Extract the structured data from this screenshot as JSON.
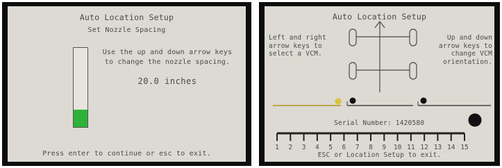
{
  "left_screen": {
    "title": "Auto Location Setup",
    "subtitle": "Set Nozzle Spacing",
    "instruction": "Use the up and down arrow keys to change the nozzle spacing.",
    "value": "20.0 inches",
    "level_fraction": 0.22,
    "fill_color": "#2fb23a",
    "footer": "Press enter to continue or esc to exit."
  },
  "right_screen": {
    "title": "Auto Location Setup",
    "left_instruction": "Left and right arrow keys to select a VCM.",
    "right_instruction": "Up and down arrow keys to change VCM orientation.",
    "serial_label": "Serial Number:",
    "serial_value": "1420580",
    "selected_color": "#d8c23a",
    "scale_numbers": [
      "1",
      "2",
      "3",
      "4",
      "5",
      "6",
      "7",
      "8",
      "9",
      "10",
      "11",
      "12",
      "13",
      "14",
      "15"
    ],
    "footer": "ESC or Location Setup to exit."
  }
}
